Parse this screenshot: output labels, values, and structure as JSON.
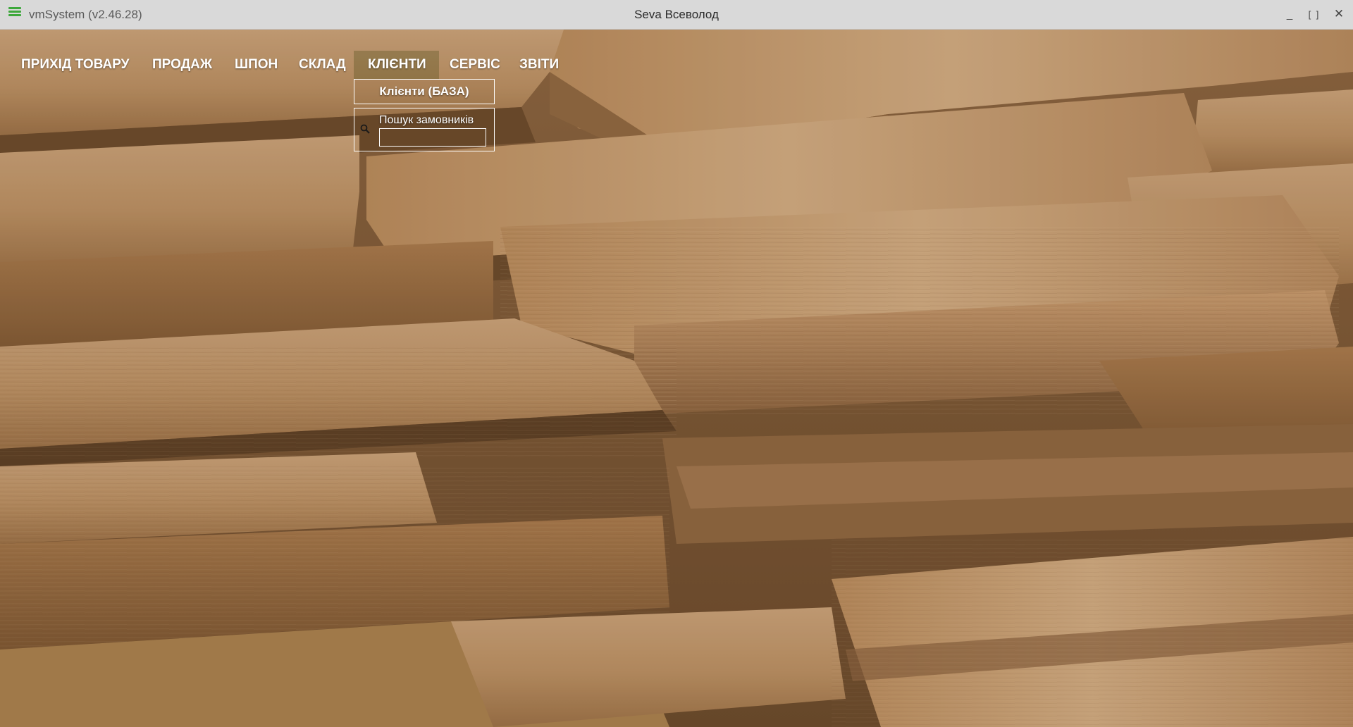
{
  "window": {
    "app_title": "vmSystem (v2.46.28)",
    "user_title": "Seva Всеволод",
    "minimize_label": "_",
    "maximize_label": "[ ]",
    "close_label": "✕"
  },
  "nav": {
    "items": [
      {
        "label": "ПРИХІД ТОВАРУ"
      },
      {
        "label": "ПРОДАЖ"
      },
      {
        "label": "ШПОН"
      },
      {
        "label": "СКЛАД"
      },
      {
        "label": "КЛІЄНТИ",
        "active": true
      },
      {
        "label": "СЕРВІС"
      },
      {
        "label": "ЗВІТИ"
      }
    ]
  },
  "clients_menu": {
    "base_label": "Клієнти (БАЗА)",
    "search_label": "Пошук замовників",
    "search_value": "",
    "search_icon": "search-icon"
  },
  "colors": {
    "accent_icon": "#3da83b",
    "menu_text": "#ffffff",
    "titlebar": "#d9d9d9"
  }
}
